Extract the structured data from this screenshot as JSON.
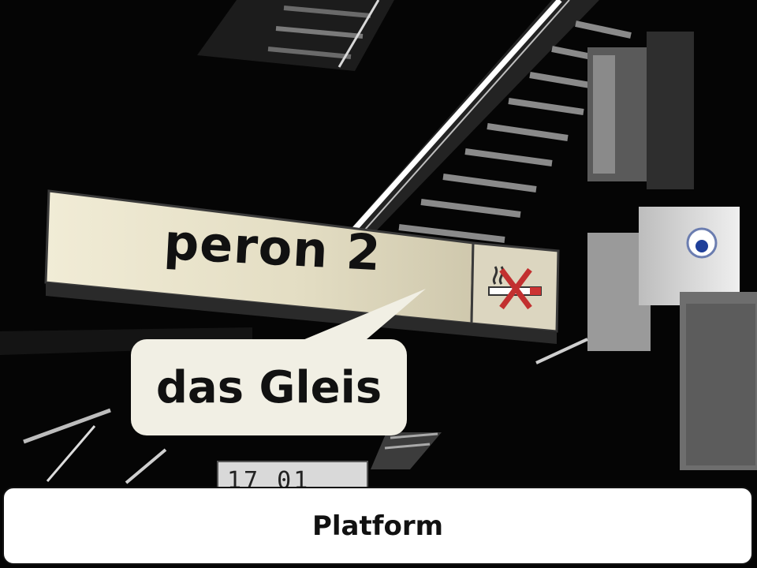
{
  "photo": {
    "sign_text": "peron 2",
    "clock_text": "17 01",
    "no_smoking_icon": "no-smoking-icon"
  },
  "speech_bubble": {
    "text": "das Gleis"
  },
  "caption": {
    "text": "Platform"
  },
  "colors": {
    "sign_face": "#e9e4cf",
    "bubble_fill": "#f1efe4",
    "caption_fill": "#ffffff",
    "background": "#050505"
  }
}
